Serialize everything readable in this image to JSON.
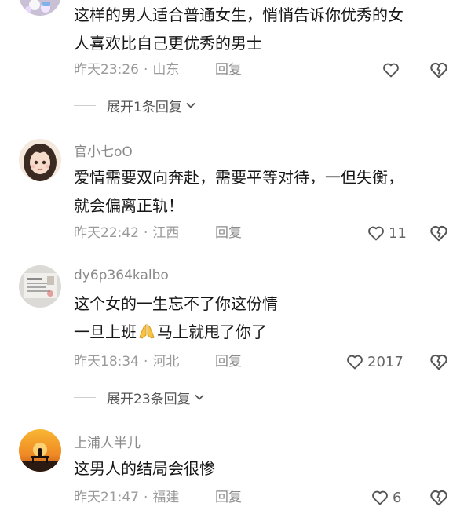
{
  "comments": [
    {
      "username": "",
      "lines": [
        "这样的男人适合普通女生，悄悄告诉你优秀的女",
        "人喜欢比自己更优秀的男士"
      ],
      "time": "昨天23:26",
      "location": "山东",
      "reply_label": "回复",
      "likes": "",
      "expand_label": "展开1条回复"
    },
    {
      "username": "官小七oO",
      "lines": [
        "爱情需要双向奔赴，需要平等对待，一但失衡，",
        "就会偏离正轨！"
      ],
      "time": "昨天22:42",
      "location": "江西",
      "reply_label": "回复",
      "likes": "11"
    },
    {
      "username": "dy6p364kalbo",
      "lines": [
        "这个女的一生忘不了你这份情"
      ],
      "line2_before": "一旦上班",
      "line2_after": "马上就甩了你了",
      "emoji": "folded-hands-emoji",
      "time": "昨天18:34",
      "location": "河北",
      "reply_label": "回复",
      "likes": "2017",
      "expand_label": "展开23条回复"
    },
    {
      "username": "上浦人半儿",
      "lines": [
        "这男人的结局会很惨"
      ],
      "time": "昨天21:47",
      "location": "福建",
      "reply_label": "回复",
      "likes": "6"
    }
  ],
  "icons": {
    "like": "heart-outline-icon",
    "dislike": "broken-heart-outline-icon",
    "expand": "chevron-down-icon"
  },
  "colors": {
    "text": "#161616",
    "muted": "#9a9a9a",
    "icon": "#555555"
  },
  "separator": "·"
}
